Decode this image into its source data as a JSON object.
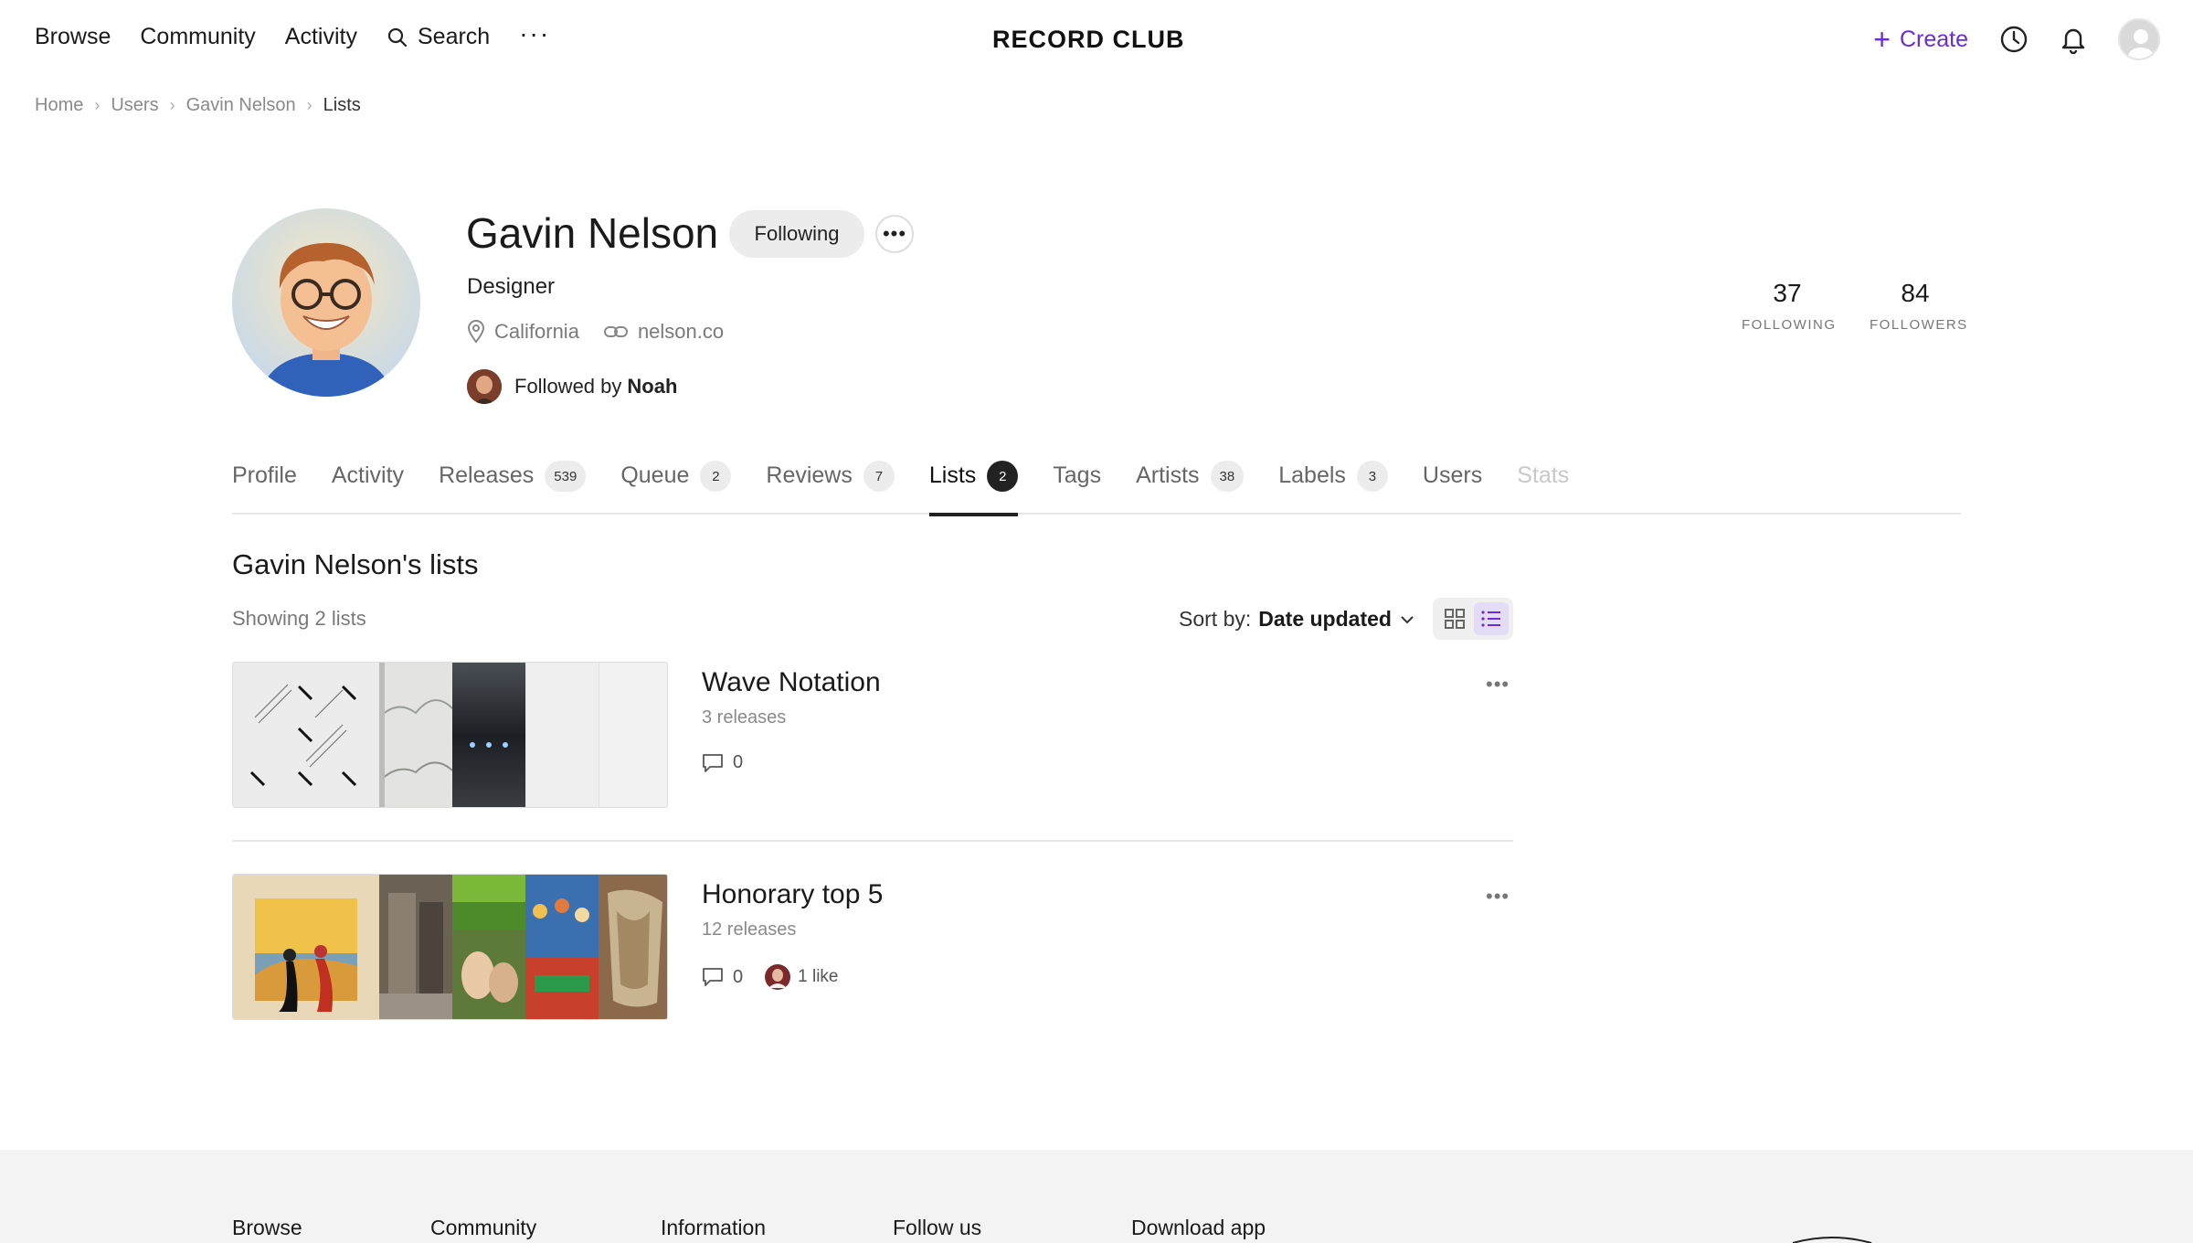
{
  "nav": {
    "browse": "Browse",
    "community": "Community",
    "activity": "Activity",
    "search": "Search",
    "more": "···",
    "logo": "RECORD CLUB",
    "create": "Create"
  },
  "breadcrumb": [
    "Home",
    "Users",
    "Gavin Nelson",
    "Lists"
  ],
  "profile": {
    "name": "Gavin Nelson",
    "following_label": "Following",
    "bio": "Designer",
    "location": "California",
    "website": "nelson.co",
    "followed_by_prefix": "Followed by",
    "followed_by_name": "Noah",
    "following_count": "37",
    "following_label_stat": "FOLLOWING",
    "followers_count": "84",
    "followers_label_stat": "FOLLOWERS"
  },
  "tabs": [
    {
      "label": "Profile",
      "count": null
    },
    {
      "label": "Activity",
      "count": null
    },
    {
      "label": "Releases",
      "count": "539"
    },
    {
      "label": "Queue",
      "count": "2"
    },
    {
      "label": "Reviews",
      "count": "7"
    },
    {
      "label": "Lists",
      "count": "2"
    },
    {
      "label": "Tags",
      "count": null
    },
    {
      "label": "Artists",
      "count": "38"
    },
    {
      "label": "Labels",
      "count": "3"
    },
    {
      "label": "Users",
      "count": null
    },
    {
      "label": "Stats",
      "count": null
    }
  ],
  "lists_section": {
    "title": "Gavin Nelson's lists",
    "showing": "Showing 2 lists",
    "sort_prefix": "Sort by:",
    "sort_value": "Date updated"
  },
  "lists": [
    {
      "title": "Wave Notation",
      "count": "3 releases",
      "comments": "0",
      "likes": ""
    },
    {
      "title": "Honorary top 5",
      "count": "12 releases",
      "comments": "0",
      "likes": "1 like"
    }
  ],
  "footer": {
    "browse": "Browse",
    "community": "Community",
    "information": "Information",
    "follow_us": "Follow us",
    "download_app": "Download app"
  },
  "colors": {
    "accent": "#6a2bd9"
  }
}
